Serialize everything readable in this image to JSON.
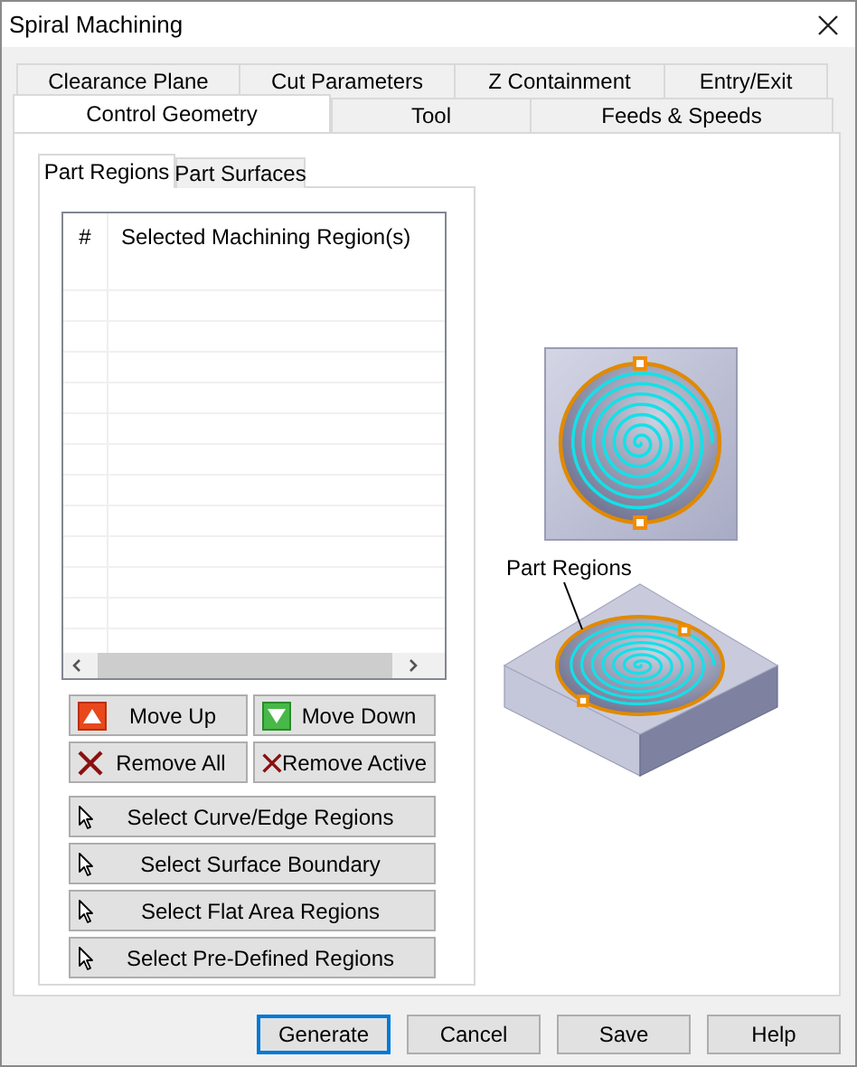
{
  "window": {
    "title": "Spiral Machining"
  },
  "tab_rows": [
    [
      {
        "label": "Clearance Plane",
        "selected": false
      },
      {
        "label": "Cut Parameters",
        "selected": false
      },
      {
        "label": "Z Containment",
        "selected": false
      },
      {
        "label": "Entry/Exit",
        "selected": false
      }
    ],
    [
      {
        "label": "Control Geometry",
        "selected": true
      },
      {
        "label": "Tool",
        "selected": false
      },
      {
        "label": "Feeds & Speeds",
        "selected": false
      }
    ]
  ],
  "subtabs": [
    {
      "label": "Part Regions",
      "selected": true
    },
    {
      "label": "Part Surfaces",
      "selected": false
    }
  ],
  "table": {
    "columns": [
      "#",
      "Selected Machining Region(s)"
    ]
  },
  "list_buttons": [
    {
      "kind": "up",
      "label": "Move Up"
    },
    {
      "kind": "down",
      "label": "Move Down"
    },
    {
      "kind": "remove",
      "label": "Remove All"
    },
    {
      "kind": "remove",
      "label": "Remove Active"
    }
  ],
  "select_buttons": [
    {
      "label": "Select Curve/Edge Regions"
    },
    {
      "label": "Select Surface Boundary"
    },
    {
      "label": "Select Flat Area Regions"
    },
    {
      "label": "Select Pre-Defined Regions"
    }
  ],
  "illustration": {
    "label": "Part Regions"
  },
  "footer_buttons": [
    {
      "label": "Generate",
      "default": true
    },
    {
      "label": "Cancel",
      "default": false
    },
    {
      "label": "Save",
      "default": false
    },
    {
      "label": "Help",
      "default": false
    }
  ]
}
